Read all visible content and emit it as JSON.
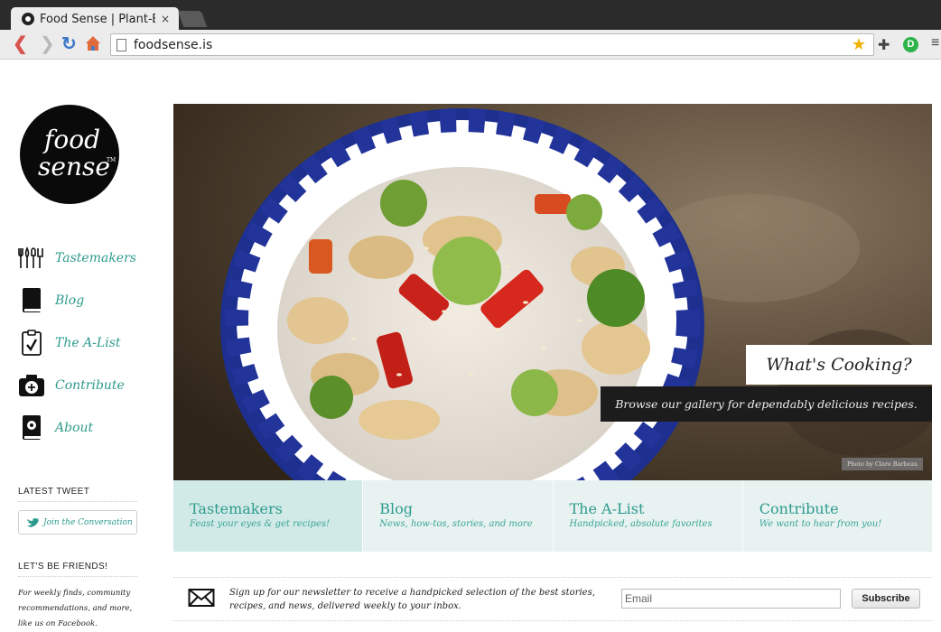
{
  "browser": {
    "tab_title": "Food Sense | Plant-B",
    "tab_close": "×",
    "url": "foodsense.is",
    "icons": [
      "back-icon",
      "forward-icon",
      "reload-icon",
      "home-icon",
      "page-icon",
      "bookmark-star-icon",
      "extension-puzzle-icon",
      "extension-d-icon",
      "menu-icon"
    ],
    "colors": {
      "back": "#d9534f",
      "reload": "#3a78c9",
      "star": "#f0b400",
      "extension": "#2db34a"
    }
  },
  "logo": {
    "line1": "food",
    "line2": "sense",
    "tm": "TM"
  },
  "sidebar": {
    "items": [
      {
        "label": "Tastemakers",
        "icon": "utensils-icon"
      },
      {
        "label": "Blog",
        "icon": "book-icon"
      },
      {
        "label": "The A-List",
        "icon": "clipboard-check-icon"
      },
      {
        "label": "Contribute",
        "icon": "camera-plus-icon"
      },
      {
        "label": "About",
        "icon": "profile-book-icon"
      }
    ],
    "latest_tweet_heading": "LATEST TWEET",
    "tweet_button": "Join the Conversation",
    "friends_heading": "LET'S BE FRIENDS!",
    "friends_text": "For weekly finds, community recommendations, and more, like us on Facebook."
  },
  "hero": {
    "caption_title": "What's Cooking?",
    "caption_sub": "Browse our gallery for dependably delicious recipes.",
    "photo_credit": "Photo by Clare Barboza"
  },
  "features": [
    {
      "title": "Tastemakers",
      "subtitle": "Feast your eyes & get recipes!"
    },
    {
      "title": "Blog",
      "subtitle": "News, how-tos, stories, and more"
    },
    {
      "title": "The A-List",
      "subtitle": "Handpicked, absolute favorites"
    },
    {
      "title": "Contribute",
      "subtitle": "We want to hear from you!"
    }
  ],
  "newsletter": {
    "text": "Sign up for our newsletter to receive a handpicked selection of the best stories, recipes, and news, delivered weekly to your inbox.",
    "email_placeholder": "Email",
    "button": "Subscribe"
  },
  "theme": {
    "accent": "#2e9b8e",
    "feature_bg": "#e7f2f1",
    "feature_active_bg": "#d2eae7"
  }
}
